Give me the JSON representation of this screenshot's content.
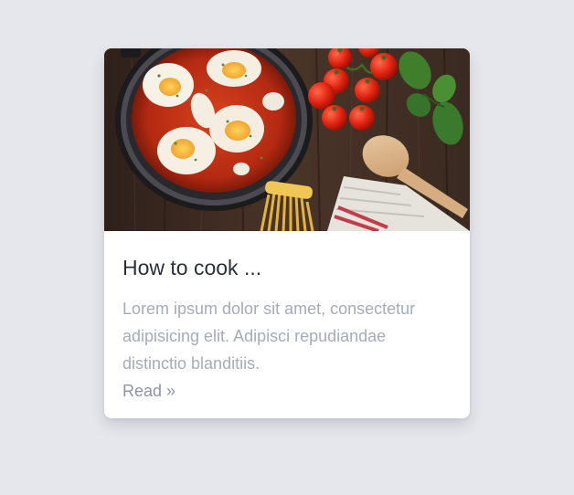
{
  "card": {
    "image_alt": "Shakshuka in a pan with tomatoes, basil, spaghetti and a wooden spoon",
    "title": "How to cook ...",
    "text": "Lorem ipsum dolor sit amet, consectetur adipisicing elit. Adipisci repudiandae distinctio blanditiis.",
    "link_label": "Read »"
  },
  "colors": {
    "page_background": "#e6e7ec",
    "card_background": "#ffffff",
    "title": "#2b2f3a",
    "body_text": "#a6abbd",
    "link": "#8e94a8"
  }
}
